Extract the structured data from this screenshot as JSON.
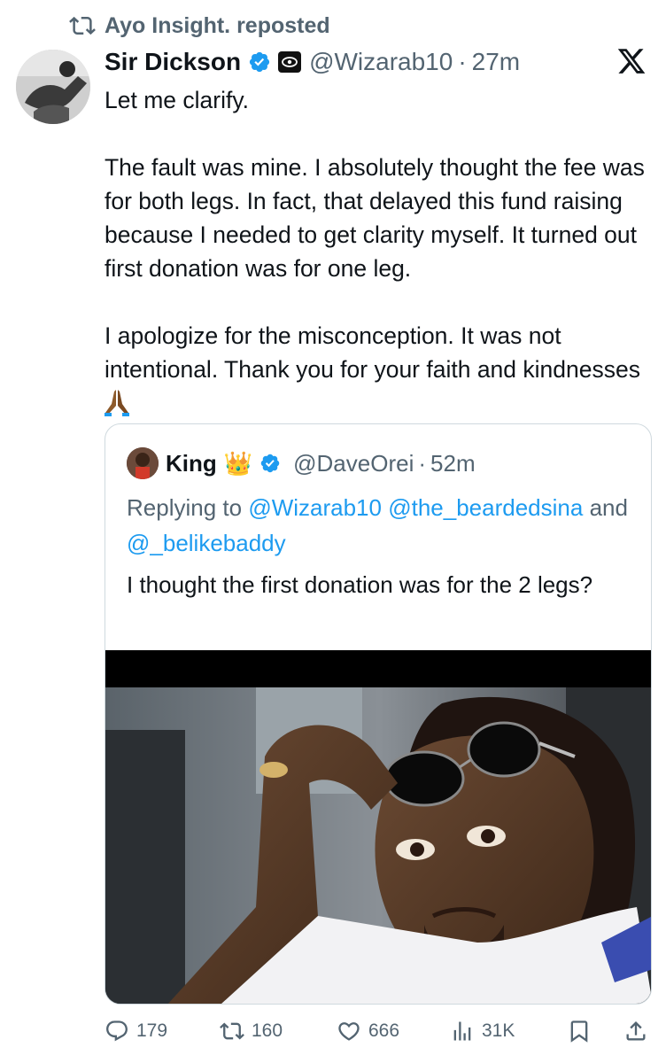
{
  "repost": {
    "label": "Ayo Insight. reposted"
  },
  "tweet": {
    "author_name": "Sir Dickson",
    "handle": "@Wizarab10",
    "separator": "·",
    "time": "27m",
    "text": {
      "p1": "Let me clarify.",
      "p2": "The fault was mine. I absolutely thought the fee was for both legs. In fact, that delayed this fund raising because I needed to get clarity myself. It turned out first donation was for one leg.",
      "p3": "I apologize for the misconception. It was not intentional. Thank you for your faith and kindnesses"
    }
  },
  "quote": {
    "author_name": "King",
    "crown": "👑",
    "handle": "@DaveOrei",
    "separator": "·",
    "time": "52m",
    "replying_prefix": "Replying to",
    "mention1": "@Wizarab10",
    "mention2": "@the_beardedsina",
    "and_text": "and",
    "mention3": "@_belikebaddy",
    "text": "I thought the first donation was for the 2 legs?"
  },
  "actions": {
    "replies": "179",
    "reposts": "160",
    "likes": "666",
    "views": "31K"
  },
  "colors": {
    "verified_blue": "#1d9bf0",
    "secondary_text": "#536471",
    "link": "#1d9bf0",
    "border": "#cfd9de"
  }
}
